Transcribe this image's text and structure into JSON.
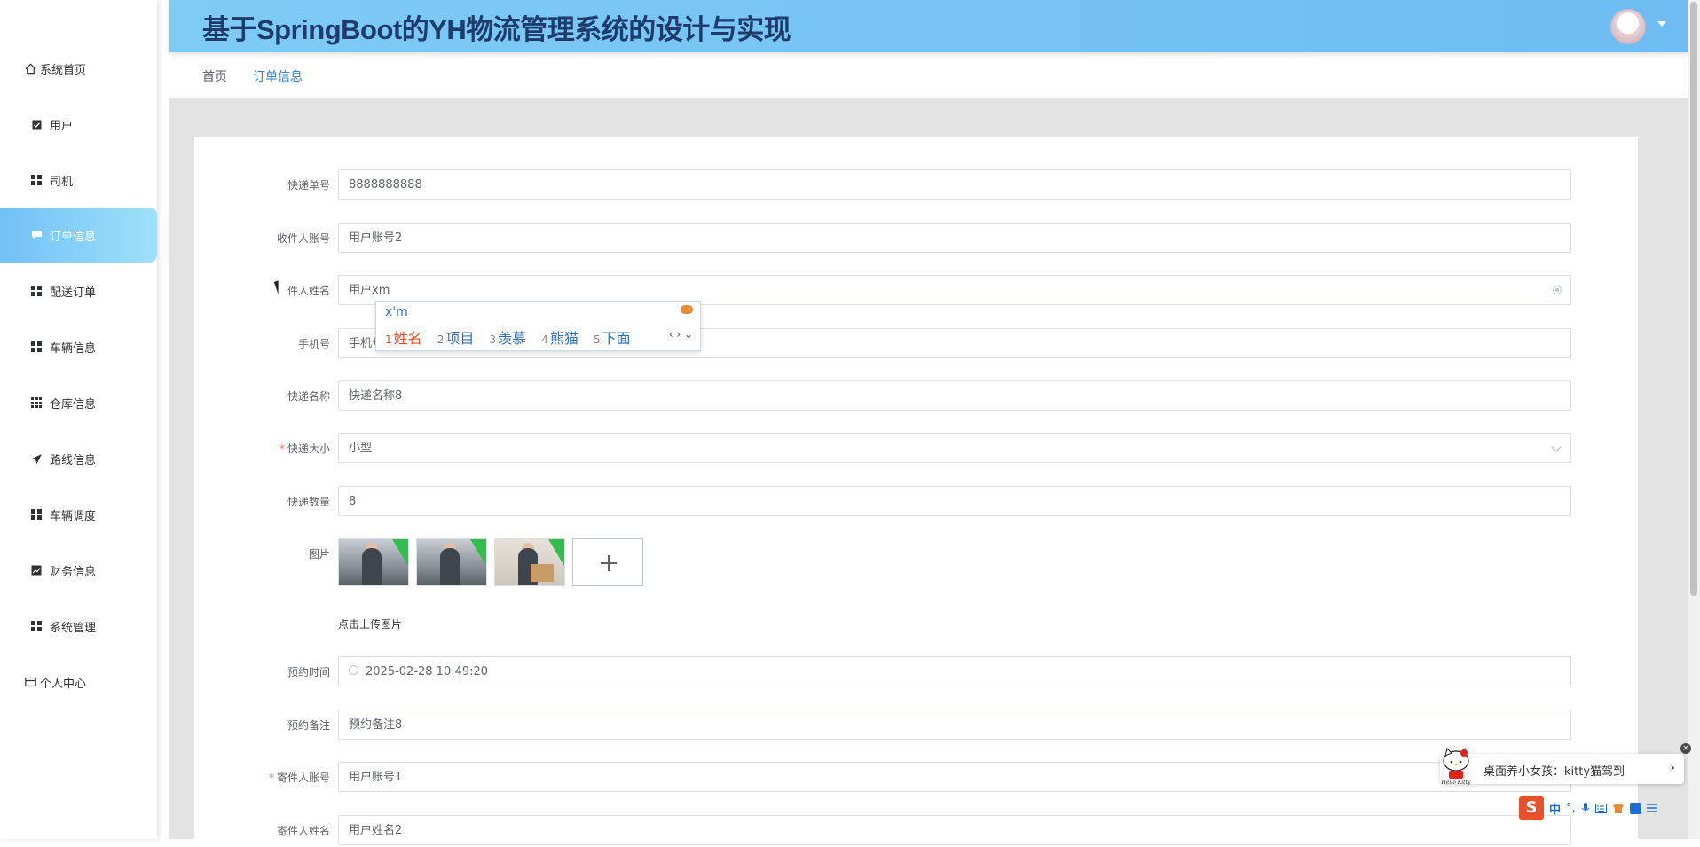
{
  "header": {
    "title": "基于SpringBoot的YH物流管理系统的设计与实现"
  },
  "sidebar": {
    "items": [
      {
        "label": "系统首页",
        "icon": "home-icon"
      },
      {
        "label": "用户",
        "icon": "clipboard-icon"
      },
      {
        "label": "司机",
        "icon": "grid-icon"
      },
      {
        "label": "订单信息",
        "icon": "chat-icon",
        "active": true
      },
      {
        "label": "配送订单",
        "icon": "grid-icon"
      },
      {
        "label": "车辆信息",
        "icon": "grid-icon"
      },
      {
        "label": "仓库信息",
        "icon": "grid-nine-icon"
      },
      {
        "label": "路线信息",
        "icon": "send-icon"
      },
      {
        "label": "车辆调度",
        "icon": "grid-icon"
      },
      {
        "label": "财务信息",
        "icon": "chart-icon"
      },
      {
        "label": "系统管理",
        "icon": "grid-icon"
      },
      {
        "label": "个人中心",
        "icon": "wallet-icon"
      }
    ]
  },
  "breadcrumb": {
    "home": "首页",
    "current": "订单信息"
  },
  "form": {
    "express_no": {
      "label": "快递单号",
      "value": "8888888888"
    },
    "receiver_account": {
      "label": "收件人账号",
      "value": "用户账号2"
    },
    "receiver_name": {
      "label": "件人姓名",
      "value": "用户xm"
    },
    "phone": {
      "label": "手机号",
      "value": "手机号"
    },
    "express_name": {
      "label": "快递名称",
      "value": "快递名称8"
    },
    "express_size": {
      "label": "快递大小",
      "value": "小型"
    },
    "express_qty": {
      "label": "快递数量",
      "value": "8"
    },
    "images": {
      "label": "图片",
      "hint": "点击上传图片"
    },
    "booking_time": {
      "label": "预约时间",
      "value": "2025-02-28 10:49:20"
    },
    "booking_note": {
      "label": "预约备注",
      "value": "预约备注8"
    },
    "sender_account": {
      "label": "寄件人账号",
      "value": "用户账号1"
    },
    "sender_name": {
      "label": "寄件人姓名",
      "value": "用户姓名2"
    }
  },
  "ime": {
    "pinyin": "x'm",
    "candidates": [
      {
        "n": "1",
        "text": "姓名"
      },
      {
        "n": "2",
        "text": "项目"
      },
      {
        "n": "3",
        "text": "羡慕"
      },
      {
        "n": "4",
        "text": "熊猫"
      },
      {
        "n": "5",
        "text": "下面"
      }
    ],
    "pager": "‹ › ⌄"
  },
  "notice": {
    "text": "桌面养小女孩：kitty猫驾到",
    "arrow": "›",
    "close": "×",
    "brand": "Hello Kitty"
  },
  "imebar": {
    "s": "S",
    "mode": "中",
    "punct": "°,"
  },
  "colors": {
    "accent": "#2f7ec6",
    "active_nav": "#71c1f6",
    "header": "#7ecbf5",
    "required": "#f56c6c"
  }
}
